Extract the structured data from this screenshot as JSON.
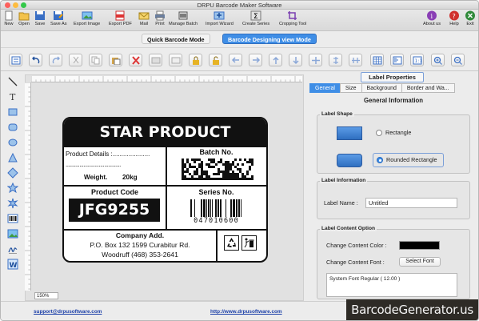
{
  "window": {
    "title": "DRPU Barcode Maker Software"
  },
  "toolbar": {
    "items": [
      "New",
      "Open",
      "Save",
      "Save As",
      "Export Image",
      "Export PDF",
      "Mail",
      "Print",
      "Manage Batch",
      "Import Wizard",
      "Create Series",
      "Cropping Tool"
    ],
    "right": [
      "About us",
      "Help",
      "Exit"
    ]
  },
  "modes": {
    "quick": "Quick Barcode Mode",
    "design": "Barcode Designing view Mode"
  },
  "canvas": {
    "zoom": "150%"
  },
  "label": {
    "title": "STAR PRODUCT",
    "product_details": "Product Details :.....................",
    "dots": "........................................",
    "weight_label": "Weight.",
    "weight_value": "20kg",
    "batch_title": "Batch No.",
    "product_code_title": "Product Code",
    "product_code": "JFG9255",
    "series_title": "Series No.",
    "series_number": "047010600",
    "company_title": "Company Add.",
    "address_line1": "P.O. Box 132 1599 Curabitur Rd.",
    "address_line2": "Woodruff (468) 353-2641"
  },
  "panel": {
    "header": "Label Properties",
    "tabs": [
      "General",
      "Size",
      "Background",
      "Border and Wa..."
    ],
    "section": "General Information",
    "shape_group": "Label Shape",
    "shape_rect": "Rectangle",
    "shape_rounded": "Rounded Rectangle",
    "shape_selected": "Rounded Rectangle",
    "info_group": "Label Information",
    "label_name_label": "Label Name :",
    "label_name_value": "Untitled",
    "content_group": "Label Content Option",
    "content_color_label": "Change Content Color :",
    "content_color": "#000000",
    "content_font_label": "Change Content Font :",
    "select_font_btn": "Select Font",
    "font_value": "System Font Regular ( 12.00 )"
  },
  "footer": {
    "support": "support@drpusoftware.com",
    "website": "http://www.drpusoftware.com"
  },
  "watermark": "BarcodeGenerator.us"
}
